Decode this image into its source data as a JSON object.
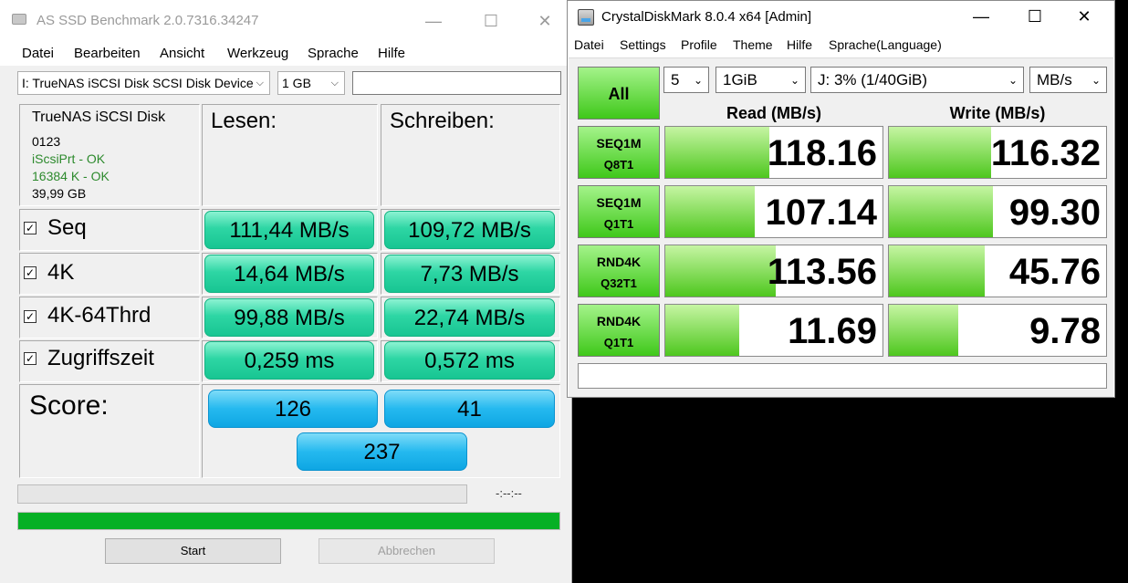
{
  "asssd": {
    "title": "AS SSD Benchmark 2.0.7316.34247",
    "menu": [
      "Datei",
      "Bearbeiten",
      "Ansicht",
      "Werkzeug",
      "Sprache",
      "Hilfe"
    ],
    "drive_select": "I: TrueNAS iSCSI Disk SCSI Disk Device",
    "size_select": "1 GB",
    "info": {
      "name": "TrueNAS iSCSI Disk",
      "firmware": "0123",
      "driver_status": "iScsiPrt - OK",
      "alignment_status": "16384 K - OK",
      "capacity": "39,99 GB"
    },
    "columns": {
      "read": "Lesen:",
      "write": "Schreiben:"
    },
    "tests": [
      {
        "label": "Seq",
        "read": "111,44 MB/s",
        "write": "109,72 MB/s"
      },
      {
        "label": "4K",
        "read": "14,64 MB/s",
        "write": "7,73 MB/s"
      },
      {
        "label": "4K-64Thrd",
        "read": "99,88 MB/s",
        "write": "22,74 MB/s"
      },
      {
        "label": "Zugriffszeit",
        "read": "0,259 ms",
        "write": "0,572 ms"
      }
    ],
    "score": {
      "label": "Score:",
      "read": "126",
      "write": "41",
      "total": "237"
    },
    "elapsed": "-:--:--",
    "progress_fraction": 1.0,
    "buttons": {
      "start": "Start",
      "abort": "Abbrechen"
    },
    "colors": {
      "result_green": "#2ed6a4",
      "score_blue": "#25b9ef",
      "progress": "#06b025",
      "status_ok": "#2d8a2d"
    }
  },
  "cdm": {
    "title": "CrystalDiskMark 8.0.4 x64 [Admin]",
    "menu": [
      "Datei",
      "Settings",
      "Profile",
      "Theme",
      "Hilfe",
      "Sprache(Language)"
    ],
    "all_label": "All",
    "count_select": "5",
    "size_select": "1GiB",
    "drive_select": "J: 3% (1/40GiB)",
    "unit_select": "MB/s",
    "read_header": "Read (MB/s)",
    "write_header": "Write (MB/s)",
    "tests": [
      {
        "line1": "SEQ1M",
        "line2": "Q8T1",
        "read": "118.16",
        "write": "116.32",
        "read_fill": 0.48,
        "write_fill": 0.47
      },
      {
        "line1": "SEQ1M",
        "line2": "Q1T1",
        "read": "107.14",
        "write": "99.30",
        "read_fill": 0.41,
        "write_fill": 0.48
      },
      {
        "line1": "RND4K",
        "line2": "Q32T1",
        "read": "113.56",
        "write": "45.76",
        "read_fill": 0.51,
        "write_fill": 0.44
      },
      {
        "line1": "RND4K",
        "line2": "Q1T1",
        "read": "11.69",
        "write": "9.78",
        "read_fill": 0.34,
        "write_fill": 0.32
      }
    ],
    "comment": "",
    "colors": {
      "accent_green": "#3fc81a"
    }
  }
}
